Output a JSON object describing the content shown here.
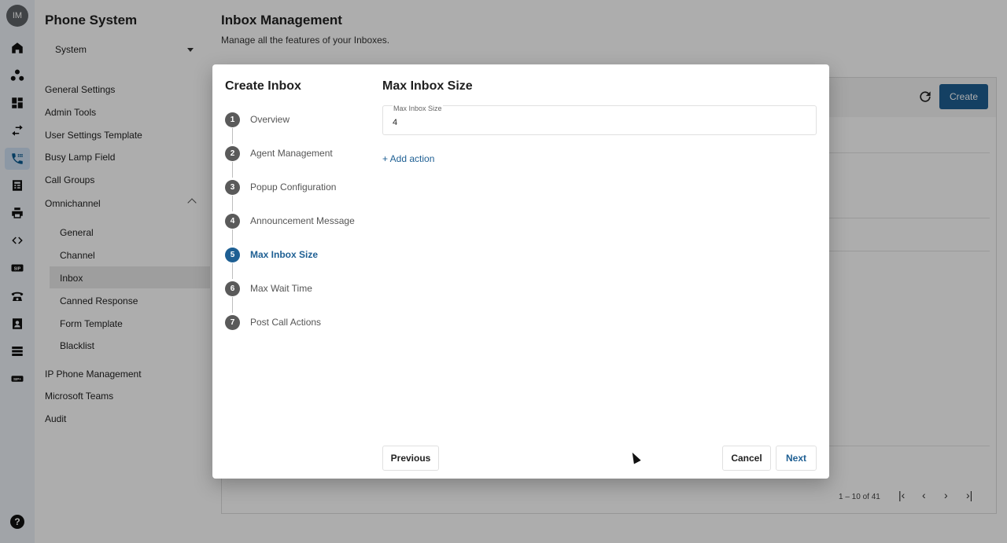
{
  "rail": {
    "avatar_initials": "IM",
    "icons": [
      "home-icon",
      "topology-icon",
      "dashboard-icon",
      "transfer-icon",
      "phone-settings-icon",
      "report-icon",
      "print-icon",
      "code-icon",
      "sip-icon",
      "telephone-icon",
      "contacts-icon",
      "server-icon",
      "sip-trunk-icon"
    ],
    "active_icon": "phone-settings-icon",
    "help_label": "?"
  },
  "sidebar": {
    "title": "Phone System",
    "select_value": "System",
    "items": [
      {
        "label": "General Settings"
      },
      {
        "label": "Admin Tools"
      },
      {
        "label": "User Settings Template"
      },
      {
        "label": "Busy Lamp Field"
      },
      {
        "label": "Call Groups"
      },
      {
        "label": "Omnichannel"
      }
    ],
    "omnichannel_items": [
      {
        "label": "General"
      },
      {
        "label": "Channel"
      },
      {
        "label": "Inbox"
      },
      {
        "label": "Canned Response"
      },
      {
        "label": "Form Template"
      },
      {
        "label": "Blacklist"
      }
    ],
    "items_after": [
      {
        "label": "IP Phone Management"
      },
      {
        "label": "Microsoft Teams"
      },
      {
        "label": "Audit"
      }
    ]
  },
  "main": {
    "title": "Inbox Management",
    "subtitle": "Manage all the features of your Inboxes.",
    "create_label": "Create",
    "pager_text": "1 – 10 of 41"
  },
  "modal": {
    "title": "Create Inbox",
    "steps": [
      {
        "num": "1",
        "label": "Overview"
      },
      {
        "num": "2",
        "label": "Agent Management"
      },
      {
        "num": "3",
        "label": "Popup Configuration"
      },
      {
        "num": "4",
        "label": "Announcement Message"
      },
      {
        "num": "5",
        "label": "Max Inbox Size"
      },
      {
        "num": "6",
        "label": "Max Wait Time"
      },
      {
        "num": "7",
        "label": "Post Call Actions"
      }
    ],
    "active_step": 5,
    "panel_title": "Max Inbox Size",
    "field_label": "Max Inbox Size",
    "field_value": "4",
    "add_action_label": "+ Add action",
    "previous_label": "Previous",
    "cancel_label": "Cancel",
    "next_label": "Next"
  },
  "colors": {
    "accent": "#1e5f93",
    "rail_bg": "#eef2f8",
    "overlay": "rgba(0,0,0,0.32)"
  }
}
